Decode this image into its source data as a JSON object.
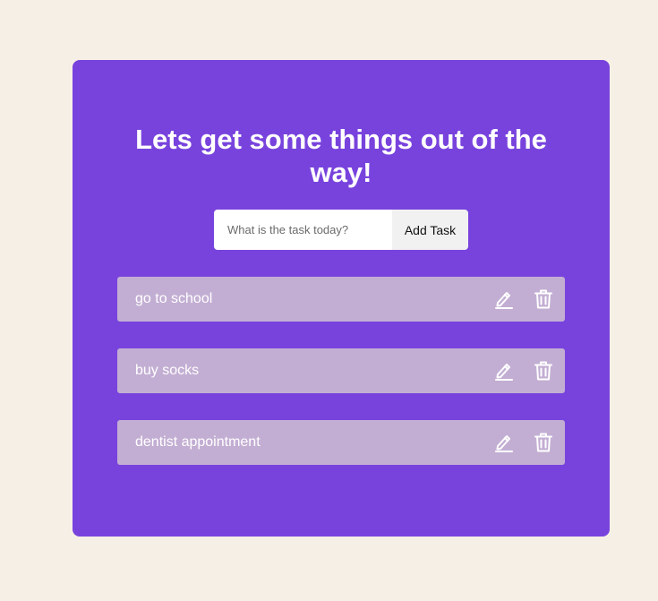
{
  "header": {
    "title": "Lets get some things out of the way!"
  },
  "form": {
    "placeholder": "What is the task today?",
    "value": "",
    "add_label": "Add Task"
  },
  "todos": [
    {
      "text": "go to school",
      "edit_icon": "pencil-icon",
      "delete_icon": "trash-icon"
    },
    {
      "text": "buy socks",
      "edit_icon": "pencil-icon",
      "delete_icon": "trash-icon"
    },
    {
      "text": "dentist appointment",
      "edit_icon": "pencil-icon",
      "delete_icon": "trash-icon"
    }
  ],
  "colors": {
    "page_background": "#f6efe6",
    "card_background": "#7843dd",
    "todo_background": "#c3aed3",
    "button_background": "#f1f1f1",
    "text_light": "#ffffff"
  }
}
